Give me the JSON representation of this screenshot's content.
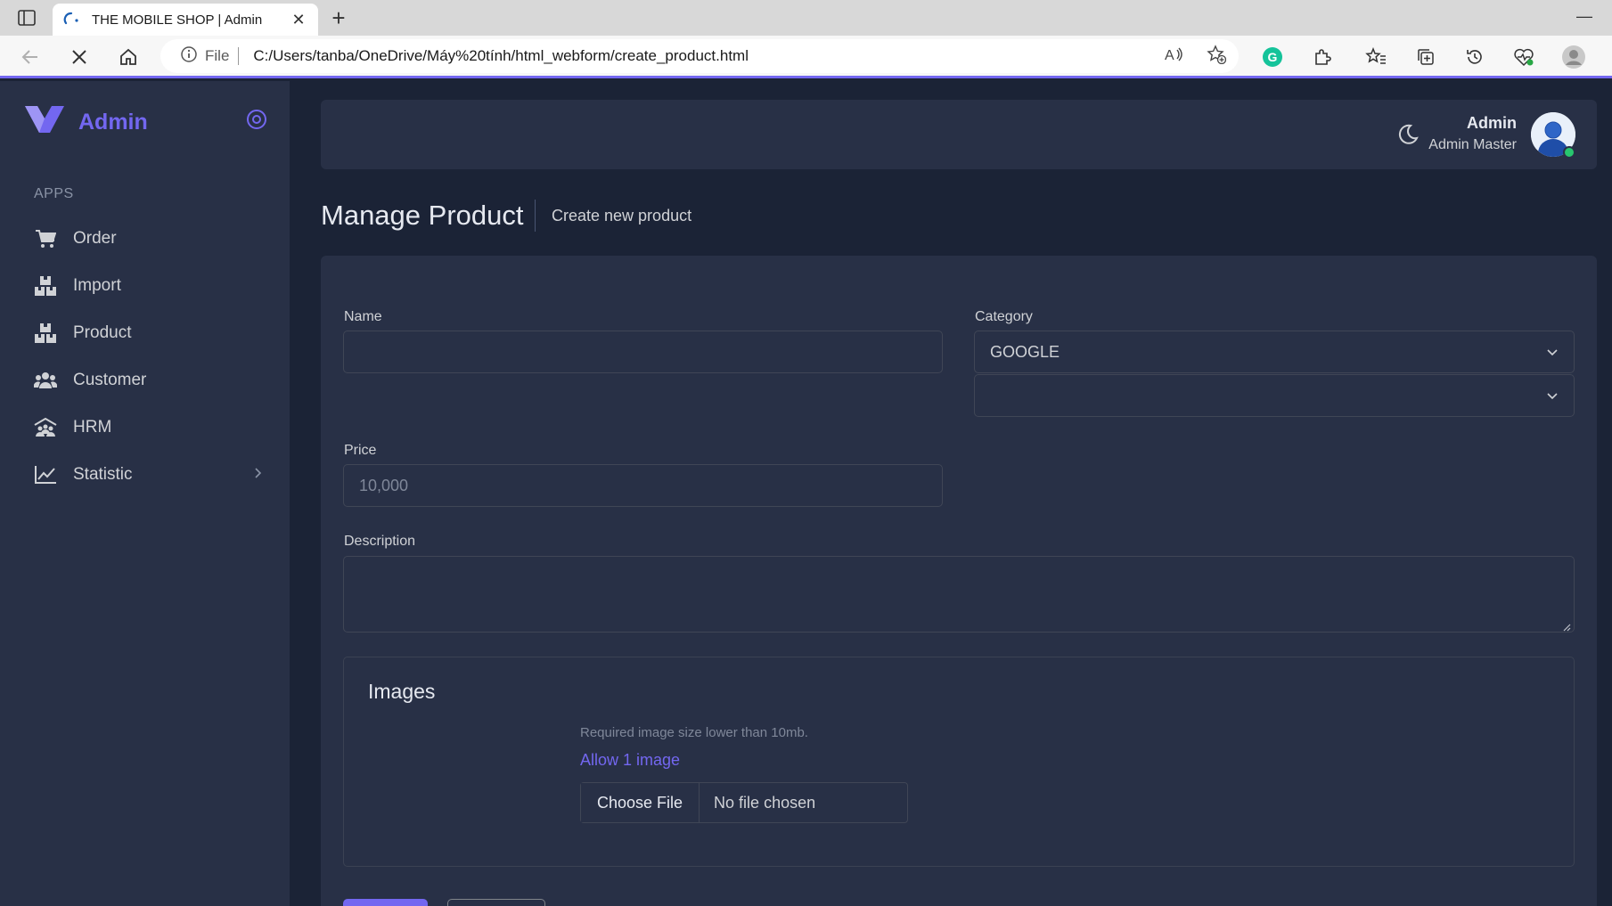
{
  "browser": {
    "tab_title": "THE MOBILE SHOP | Admin",
    "url_scheme": "File",
    "url": "C:/Users/tanba/OneDrive/Máy%20tính/html_webform/create_product.html"
  },
  "sidebar": {
    "brand": "Admin",
    "section_label": "APPS",
    "items": [
      {
        "label": "Order",
        "icon": "cart-icon"
      },
      {
        "label": "Import",
        "icon": "boxes-icon"
      },
      {
        "label": "Product",
        "icon": "boxes-icon"
      },
      {
        "label": "Customer",
        "icon": "users-icon"
      },
      {
        "label": "HRM",
        "icon": "team-icon"
      },
      {
        "label": "Statistic",
        "icon": "chart-line-icon"
      }
    ]
  },
  "header": {
    "user_name": "Admin",
    "user_role": "Admin Master"
  },
  "page": {
    "title": "Manage Product",
    "subtitle": "Create new product"
  },
  "form": {
    "name_label": "Name",
    "name_value": "",
    "category_label": "Category",
    "category_value": "GOOGLE",
    "subcategory_value": "",
    "price_label": "Price",
    "price_placeholder": "10,000",
    "description_label": "Description",
    "images_title": "Images",
    "images_note": "Required image size lower than 10mb.",
    "images_allow": "Allow 1 image",
    "file_button": "Choose File",
    "file_status": "No file chosen"
  },
  "colors": {
    "accent": "#7367f0",
    "sidebar_bg": "#283046",
    "page_bg": "#1b2336",
    "online": "#28c76f"
  }
}
